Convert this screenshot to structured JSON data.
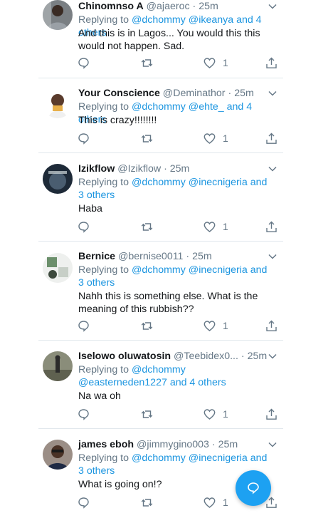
{
  "colors": {
    "accent": "#1da1f2",
    "mention": "#1b95e0",
    "muted": "#657786",
    "divider": "#e1e8ed"
  },
  "tweets": [
    {
      "name": "Chinomnso A",
      "handle": "@ajaeroc",
      "separator": "·",
      "time": "25m",
      "replying_prefix": "Replying to",
      "mentions": [
        "@dchommy",
        "@ikeanya",
        "and 4 others"
      ],
      "text": "And this is in Lagos...  You would this this would not happen. Sad.",
      "like_count": "1"
    },
    {
      "name": "Your Conscience",
      "handle": "@Deminathor",
      "separator": "·",
      "time": "25m",
      "replying_prefix": "Replying to",
      "mentions": [
        "@dchommy",
        "@ehte_",
        "and 4 others"
      ],
      "text": "This is crazy!!!!!!!!",
      "like_count": "1"
    },
    {
      "name": "Izikflow",
      "handle": "@Izikflow",
      "separator": "·",
      "time": "25m",
      "replying_prefix": "Replying to",
      "mentions": [
        "@dchommy",
        "@inecnigeria",
        "and 3 others"
      ],
      "text": "Haba",
      "like_count": "1"
    },
    {
      "name": "Bernice",
      "handle": "@bernise0011",
      "separator": "·",
      "time": "25m",
      "replying_prefix": "Replying to",
      "mentions": [
        "@dchommy",
        "@inecnigeria",
        "and 3 others"
      ],
      "text": "Nahh this is something else. What is the meaning of this rubbish??",
      "like_count": "1"
    },
    {
      "name": "Iselowo oluwatosin",
      "handle": "@Teebidex0...",
      "separator": "·",
      "time": "25m",
      "replying_prefix": "Replying to",
      "mentions": [
        "@dchommy",
        "@easterneden1227",
        "and 4 others"
      ],
      "text": "Na wa oh",
      "like_count": "1"
    },
    {
      "name": "james eboh",
      "handle": "@jimmygino003",
      "separator": "·",
      "time": "25m",
      "replying_prefix": "Replying to",
      "mentions": [
        "@dchommy",
        "@inecnigeria",
        "and 3 others"
      ],
      "text": "What is going on!?",
      "like_count": "1"
    }
  ],
  "icons": {
    "reply": "reply-icon",
    "retweet": "retweet-icon",
    "like": "heart-icon",
    "share": "share-icon",
    "menu": "chevron-down-icon",
    "compose": "compose-reply-icon"
  }
}
